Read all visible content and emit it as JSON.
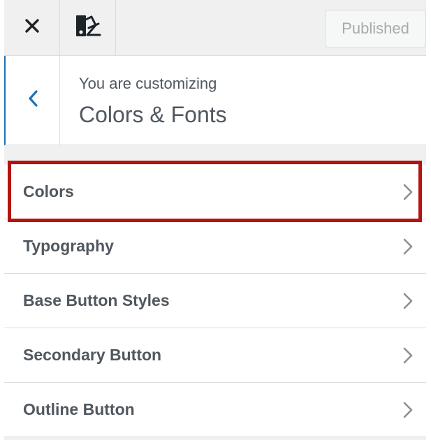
{
  "header": {
    "close_icon": "close-icon",
    "style_icon": "paint-swatch-icon",
    "publish_label": "Published"
  },
  "section": {
    "back_icon": "chevron-left-icon",
    "customizing_label": "You are customizing",
    "title": "Colors & Fonts"
  },
  "items": [
    {
      "label": "Colors"
    },
    {
      "label": "Typography"
    },
    {
      "label": "Base Button Styles"
    },
    {
      "label": "Secondary Button"
    },
    {
      "label": "Outline Button"
    }
  ],
  "highlight": {
    "color": "#b4140f",
    "target": "Colors"
  },
  "colors": {
    "accent": "#2271b1",
    "text": "#50575e",
    "border": "#dcdcde",
    "panel_bg": "#f0f0f1"
  }
}
